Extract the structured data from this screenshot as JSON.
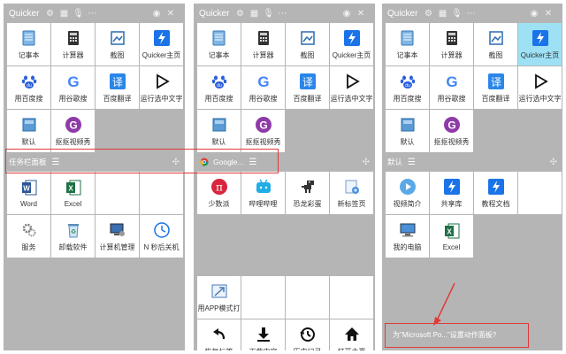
{
  "app_name": "Quicker",
  "panels": [
    {
      "title": "Quicker",
      "grid1": [
        {
          "label": "记事本",
          "icon": "notepad-icon"
        },
        {
          "label": "计算器",
          "icon": "calculator-icon"
        },
        {
          "label": "截图",
          "icon": "screenshot-icon"
        },
        {
          "label": "Quicker主页",
          "icon": "quicker-bolt-icon"
        },
        {
          "label": "用百度搜",
          "icon": "baidu-paw-icon"
        },
        {
          "label": "用谷歌搜",
          "icon": "google-g-icon"
        },
        {
          "label": "百度翻译",
          "icon": "translate-icon"
        },
        {
          "label": "运行选中文字",
          "icon": "play-triangle-icon"
        },
        {
          "label": "默认",
          "icon": "default-box-icon"
        },
        {
          "label": "抠抠视频秀",
          "icon": "video-g-icon"
        }
      ],
      "section": "任务栏面板",
      "grid2": [
        {
          "label": "Word",
          "icon": "word-icon"
        },
        {
          "label": "Excel",
          "icon": "excel-icon"
        },
        {
          "label": "",
          "icon": ""
        },
        {
          "label": "",
          "icon": ""
        },
        {
          "label": "服务",
          "icon": "services-gear-icon"
        },
        {
          "label": "卸载软件",
          "icon": "recycle-icon"
        },
        {
          "label": "计算机管理",
          "icon": "computer-manage-icon"
        },
        {
          "label": "N 秒后关机",
          "icon": "clock-icon"
        }
      ]
    },
    {
      "title": "Quicker",
      "grid1": [
        {
          "label": "记事本",
          "icon": "notepad-icon"
        },
        {
          "label": "计算器",
          "icon": "calculator-icon"
        },
        {
          "label": "截图",
          "icon": "screenshot-icon"
        },
        {
          "label": "Quicker主页",
          "icon": "quicker-bolt-icon"
        },
        {
          "label": "用百度搜",
          "icon": "baidu-paw-icon"
        },
        {
          "label": "用谷歌搜",
          "icon": "google-g-icon"
        },
        {
          "label": "百度翻译",
          "icon": "translate-icon"
        },
        {
          "label": "运行选中文字",
          "icon": "play-triangle-icon"
        },
        {
          "label": "默认",
          "icon": "default-box-icon"
        },
        {
          "label": "抠抠视频秀",
          "icon": "video-g-icon"
        }
      ],
      "section": "Google...",
      "grid2": [
        {
          "label": "少数派",
          "icon": "sspai-pi-icon"
        },
        {
          "label": "哔哩哔哩",
          "icon": "bilibili-tv-icon"
        },
        {
          "label": "恐龙彩蛋",
          "icon": "dino-icon"
        },
        {
          "label": "新标签页",
          "icon": "new-tab-icon"
        }
      ],
      "grid3": [
        {
          "label": "用APP模式打开",
          "icon": "app-window-icon"
        },
        {
          "label": "",
          "icon": ""
        },
        {
          "label": "",
          "icon": ""
        },
        {
          "label": "",
          "icon": ""
        },
        {
          "label": "恢复标签",
          "icon": "restore-arrow-icon"
        },
        {
          "label": "下载内容",
          "icon": "download-icon"
        },
        {
          "label": "历史记录",
          "icon": "history-icon"
        },
        {
          "label": "打开主页",
          "icon": "home-icon"
        }
      ]
    },
    {
      "title": "Quicker",
      "grid1": [
        {
          "label": "记事本",
          "icon": "notepad-icon"
        },
        {
          "label": "计算器",
          "icon": "calculator-icon"
        },
        {
          "label": "截图",
          "icon": "screenshot-icon"
        },
        {
          "label": "Quicker主页",
          "icon": "quicker-bolt-icon",
          "selected": true
        },
        {
          "label": "用百度搜",
          "icon": "baidu-paw-icon"
        },
        {
          "label": "用谷歌搜",
          "icon": "google-g-icon"
        },
        {
          "label": "百度翻译",
          "icon": "translate-icon"
        },
        {
          "label": "运行选中文字",
          "icon": "play-triangle-icon"
        },
        {
          "label": "默认",
          "icon": "default-box-icon"
        },
        {
          "label": "抠抠视频秀",
          "icon": "video-g-icon"
        }
      ],
      "section": "默认",
      "grid2": [
        {
          "label": "视频简介",
          "icon": "video-play-icon"
        },
        {
          "label": "共享库",
          "icon": "quicker-bolt-icon"
        },
        {
          "label": "教程文档",
          "icon": "quicker-bolt-icon"
        },
        {
          "label": "",
          "icon": ""
        },
        {
          "label": "我的电脑",
          "icon": "computer-icon"
        },
        {
          "label": "Excel",
          "icon": "excel-icon"
        }
      ],
      "footer": "为\"Microsoft Po...\"设置动作面板?"
    }
  ],
  "colors": {
    "panel_bg": "#b5b5b5",
    "cell_bg": "#ffffff",
    "selected_bg": "#9ee1f5",
    "highlight": "#e03a3a",
    "accent_blue": "#1a73e8"
  }
}
